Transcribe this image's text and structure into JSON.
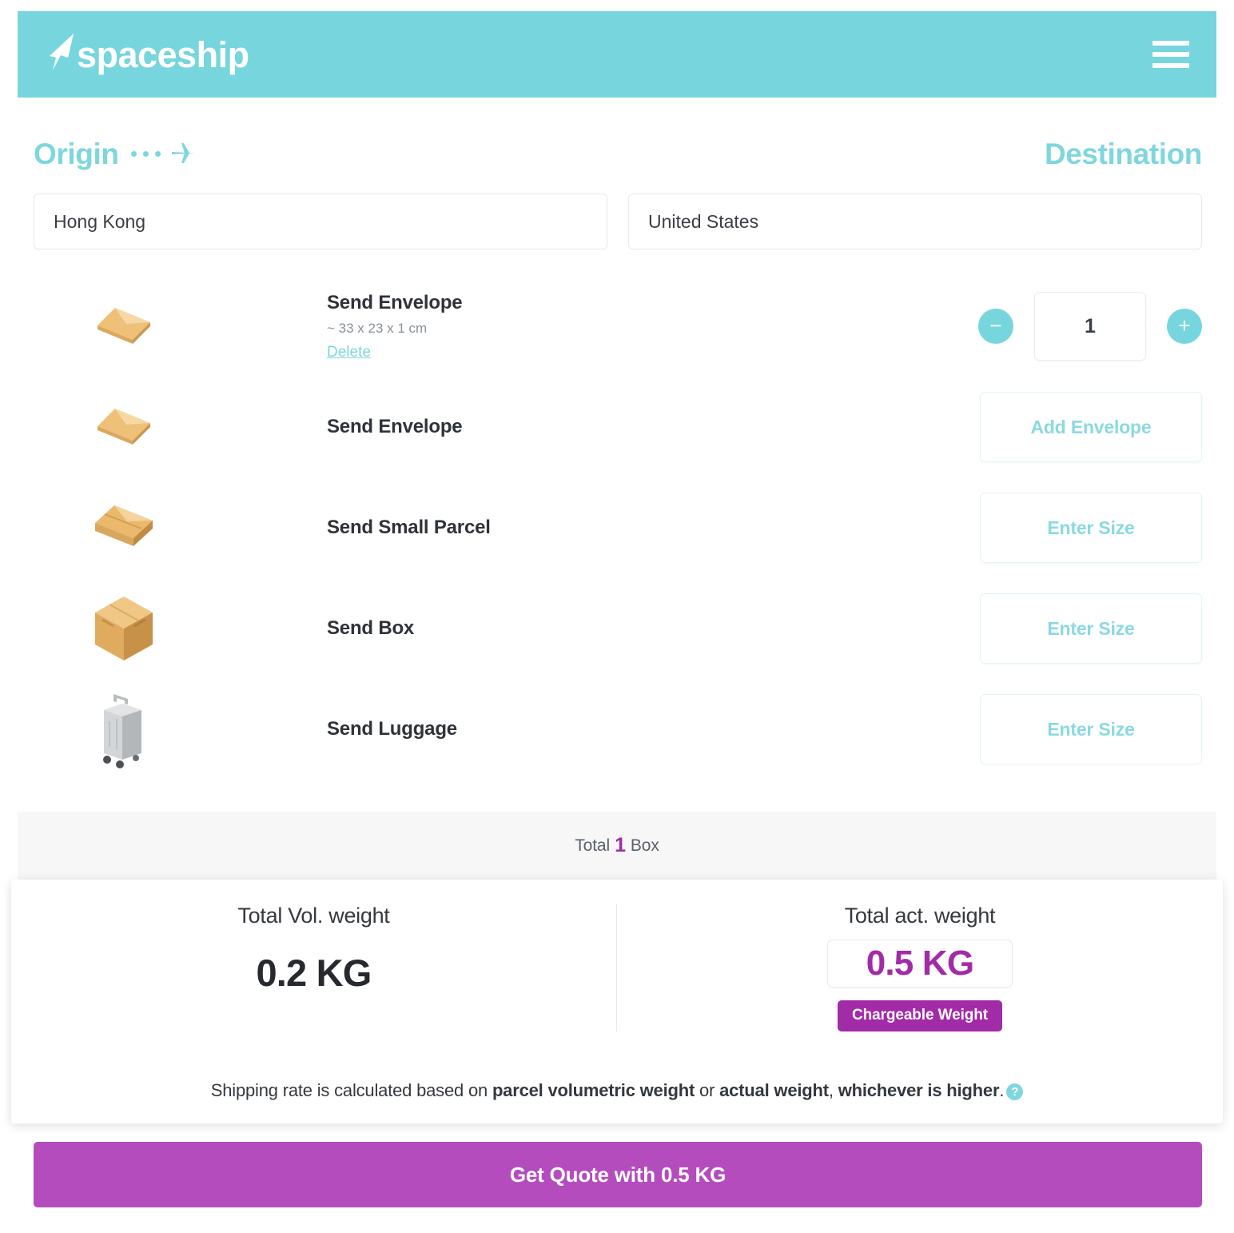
{
  "brand": {
    "name": "spaceship",
    "logo_icon": "spaceship-arrow-icon",
    "menu_icon": "hamburger-menu-icon",
    "header_bg": "#77d5dd"
  },
  "route": {
    "origin": {
      "label": "Origin",
      "value": "Hong Kong",
      "plane_icon": "airplane-icon"
    },
    "destination": {
      "label": "Destination",
      "value": "United States"
    },
    "label_color": "#7fd6de"
  },
  "options": [
    {
      "icon": "envelope-icon",
      "title": "Send Envelope",
      "dimensions": "~ 33 x 23 x 1 cm",
      "delete_label": "Delete",
      "action": "stepper",
      "quantity": "1",
      "minus_label": "−",
      "plus_label": "+"
    },
    {
      "icon": "envelope-icon",
      "title": "Send Envelope",
      "action": "button",
      "action_label": "Add Envelope"
    },
    {
      "icon": "small-parcel-icon",
      "title": "Send Small Parcel",
      "action": "button",
      "action_label": "Enter Size"
    },
    {
      "icon": "box-icon",
      "title": "Send Box",
      "action": "button",
      "action_label": "Enter Size"
    },
    {
      "icon": "luggage-icon",
      "title": "Send Luggage",
      "action": "button",
      "action_label": "Enter Size"
    }
  ],
  "total_bar": {
    "prefix": "Total",
    "count": "1",
    "suffix": "Box",
    "count_color": "#a22ba8"
  },
  "weights": {
    "volumetric": {
      "label": "Total Vol. weight",
      "value": "0.2 KG"
    },
    "actual": {
      "label": "Total act. weight",
      "value": "0.5 KG",
      "badge": "Chargeable Weight",
      "color": "#a22ba8"
    },
    "note": {
      "part1": "Shipping rate is calculated based on ",
      "bold1": "parcel volumetric weight",
      "part2": " or ",
      "bold2": "actual weight",
      "part3": ", ",
      "bold3": "whichever is higher",
      "part4": ".",
      "help_icon": "question-mark-icon",
      "help_glyph": "?"
    }
  },
  "cta": {
    "label": "Get Quote with 0.5 KG",
    "color": "#b44cbd"
  }
}
